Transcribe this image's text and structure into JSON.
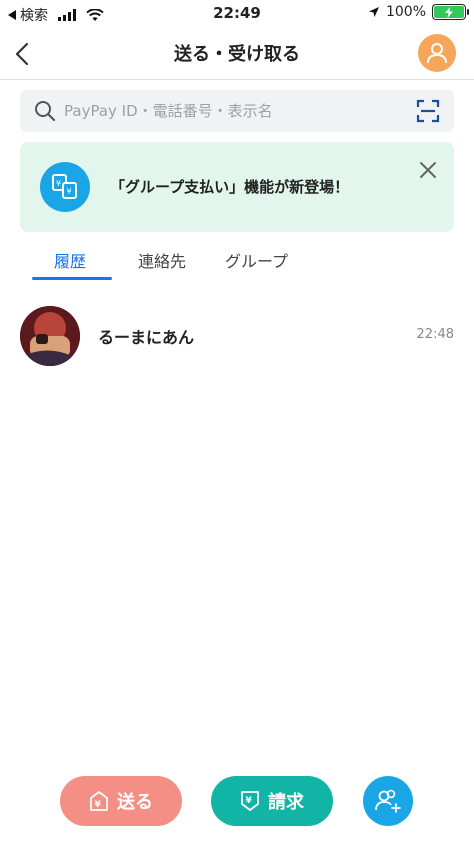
{
  "status_bar": {
    "back_app": "検索",
    "time": "22:49",
    "battery": "100%"
  },
  "header": {
    "title": "送る・受け取る"
  },
  "search": {
    "placeholder": "PayPay ID・電話番号・表示名"
  },
  "banner": {
    "text": "「グループ支払い」機能が新登場！"
  },
  "tabs": [
    {
      "label": "履歴",
      "active": true
    },
    {
      "label": "連絡先",
      "active": false
    },
    {
      "label": "グループ",
      "active": false
    }
  ],
  "history": [
    {
      "name": "るーまにあん",
      "time": "22:48"
    }
  ],
  "bottom": {
    "send_label": "送る",
    "request_label": "請求"
  },
  "colors": {
    "accent_blue": "#1a73e8",
    "send": "#f38f84",
    "request": "#12b5a5",
    "add_friend": "#1aa6e6",
    "banner_bg": "#e3f6ee"
  }
}
